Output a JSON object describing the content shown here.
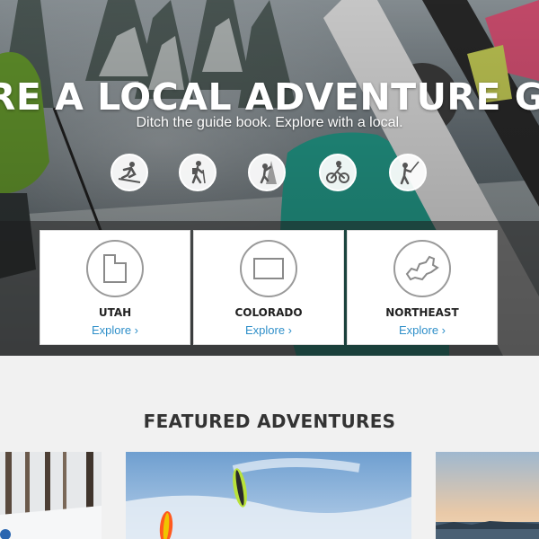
{
  "hero": {
    "title": "IRE A LOCAL ADVENTURE GUID",
    "subtitle": "Ditch the guide book. Explore with a local.",
    "activities": [
      {
        "name": "skiing",
        "icon": "skier-icon"
      },
      {
        "name": "hiking",
        "icon": "hiker-icon"
      },
      {
        "name": "climbing",
        "icon": "climber-icon"
      },
      {
        "name": "mountain biking",
        "icon": "mountain-biker-icon"
      },
      {
        "name": "fishing",
        "icon": "angler-icon"
      }
    ]
  },
  "regions": [
    {
      "name": "UTAH",
      "link": "Explore ›",
      "icon": "utah-map-icon"
    },
    {
      "name": "COLORADO",
      "link": "Explore ›",
      "icon": "colorado-map-icon"
    },
    {
      "name": "NORTHEAST",
      "link": "Explore ›",
      "icon": "northeast-map-icon"
    }
  ],
  "featured": {
    "title": "FEATURED ADVENTURES",
    "items": [
      {
        "image": "snowy-forest-photo"
      },
      {
        "image": "kite-skiing-photo"
      },
      {
        "image": "sunset-lake-photo"
      }
    ]
  },
  "colors": {
    "link": "#2f8fc9",
    "heading": "#333333",
    "card_bg": "#ffffff",
    "page_bg": "#f1f1f1"
  }
}
